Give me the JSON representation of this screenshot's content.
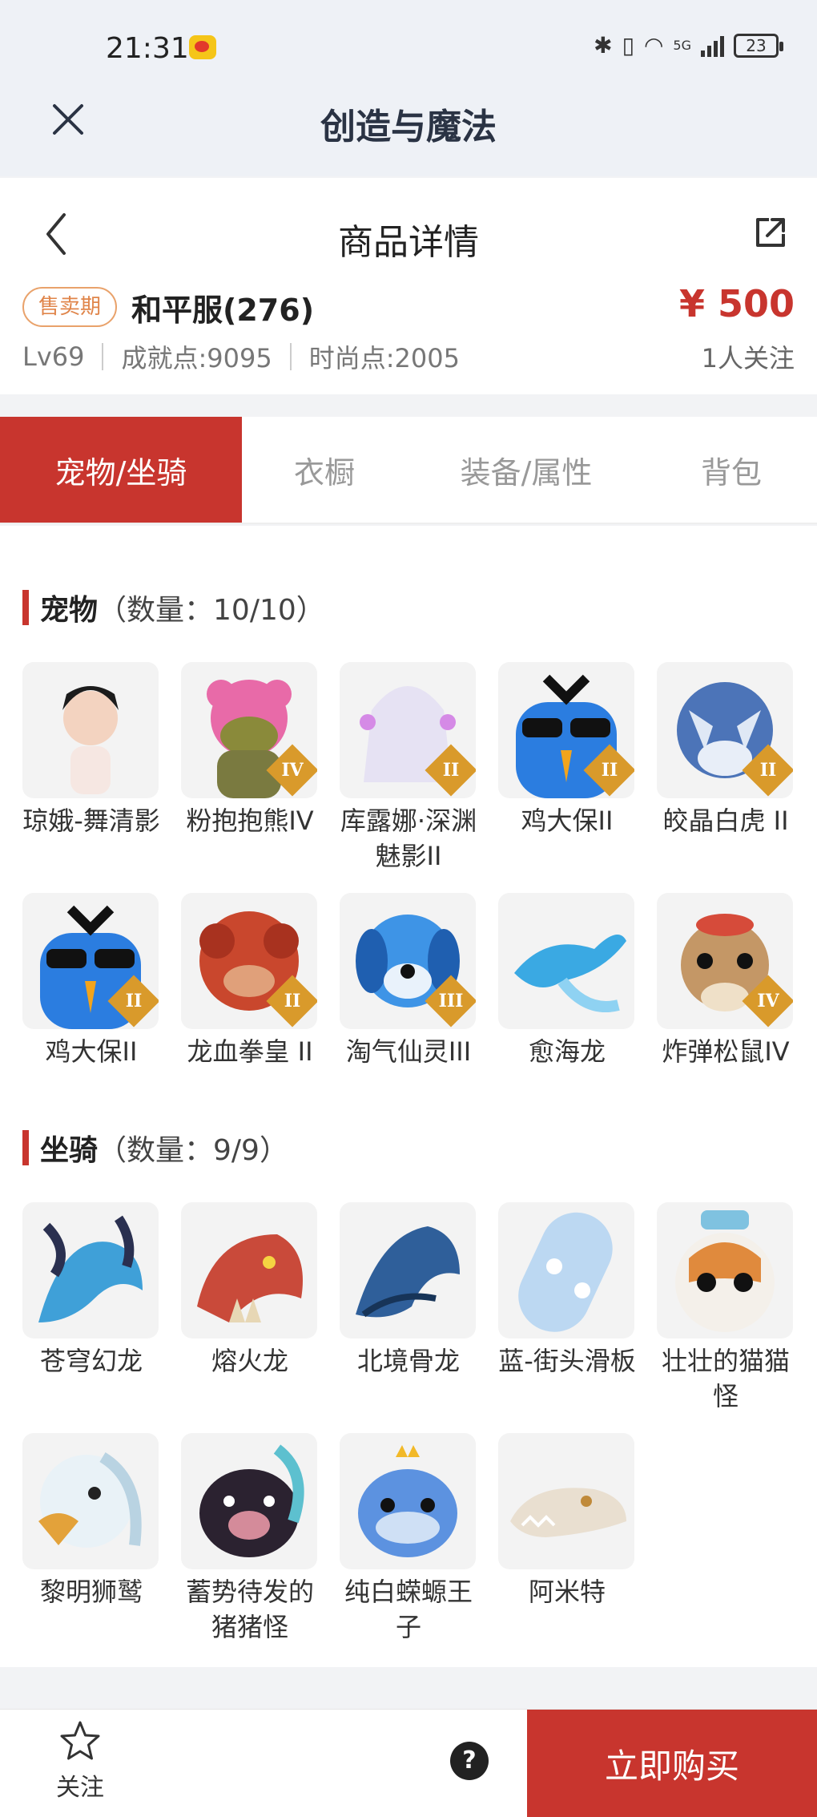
{
  "status_bar": {
    "time": "21:31",
    "battery": "23",
    "network": "5G"
  },
  "app_header": {
    "title": "创造与魔法"
  },
  "detail": {
    "title": "商品详情",
    "sale_badge": "售卖期",
    "server": "和平服(276)",
    "price": "¥ 500",
    "followers": "1人关注",
    "level": "Lv69",
    "achievement": "成就点:9095",
    "fashion": "时尚点:2005"
  },
  "tabs": [
    {
      "label": "宠物/坐骑",
      "active": true
    },
    {
      "label": "衣橱",
      "active": false
    },
    {
      "label": "装备/属性",
      "active": false
    },
    {
      "label": "背包",
      "active": false
    }
  ],
  "pets": {
    "title": "宠物",
    "count": "（数量：10/10）",
    "items": [
      {
        "name": "琼娥-舞清影",
        "icon": "maiden-icon",
        "grade": ""
      },
      {
        "name": "粉抱抱熊IV",
        "icon": "pink-bear-icon",
        "grade": "IV"
      },
      {
        "name": "库露娜·深渊魅影II",
        "icon": "white-spirit-icon",
        "grade": "II"
      },
      {
        "name": "鸡大保II",
        "icon": "blue-bird-icon",
        "grade": "II"
      },
      {
        "name": "皎晶白虎 II",
        "icon": "crystal-tiger-icon",
        "grade": "II"
      },
      {
        "name": "鸡大保II",
        "icon": "blue-bird-icon",
        "grade": "II"
      },
      {
        "name": "龙血拳皇 II",
        "icon": "red-dragon-icon",
        "grade": "II"
      },
      {
        "name": "淘气仙灵III",
        "icon": "blue-pup-icon",
        "grade": "III"
      },
      {
        "name": "愈海龙",
        "icon": "sea-dragon-icon",
        "grade": ""
      },
      {
        "name": "炸弹松鼠IV",
        "icon": "squirrel-icon",
        "grade": "IV"
      }
    ]
  },
  "mounts": {
    "title": "坐骑",
    "count": "（数量：9/9）",
    "items": [
      {
        "name": "苍穹幻龙",
        "icon": "sky-dragon-icon"
      },
      {
        "name": "熔火龙",
        "icon": "lava-dragon-icon"
      },
      {
        "name": "北境骨龙",
        "icon": "bone-dragon-icon"
      },
      {
        "name": "蓝-街头滑板",
        "icon": "skateboard-icon"
      },
      {
        "name": "壮壮的猫猫怪",
        "icon": "cat-icon"
      },
      {
        "name": "黎明狮鹫",
        "icon": "griffin-icon"
      },
      {
        "name": "蓄势待发的猪猪怪",
        "icon": "pig-icon"
      },
      {
        "name": "纯白蝾螈王子",
        "icon": "axolotl-icon"
      },
      {
        "name": "阿米特",
        "icon": "crocodile-icon"
      }
    ]
  },
  "bottom": {
    "follow": "关注",
    "help": "?",
    "buy": "立即购买"
  },
  "colors": {
    "accent": "#c8352e",
    "badge": "#e0854a"
  }
}
